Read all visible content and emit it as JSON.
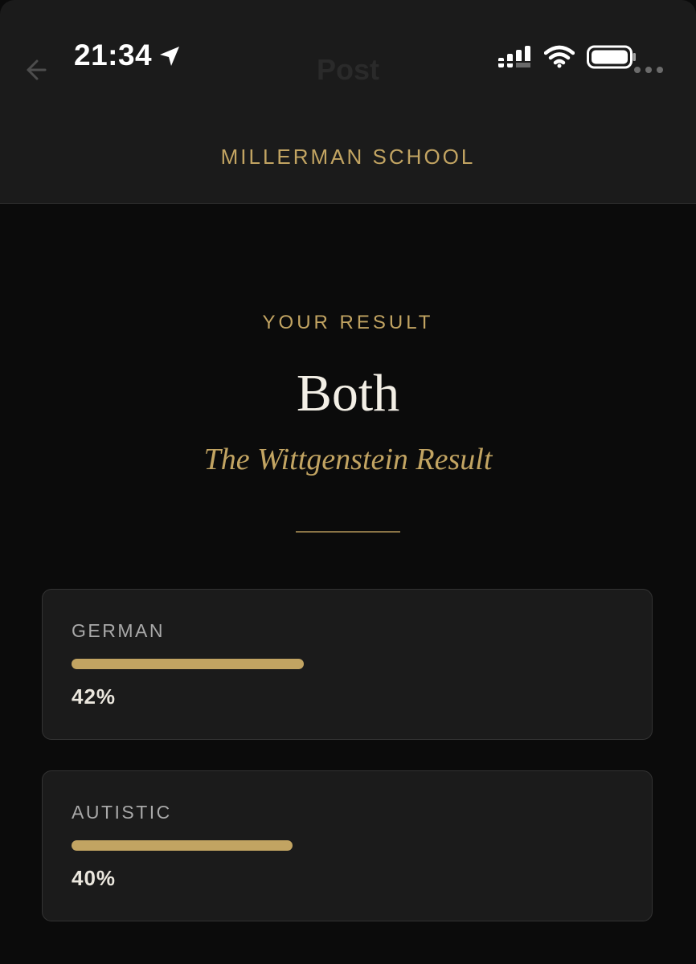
{
  "status_bar": {
    "time": "21:34",
    "icons": [
      "location-arrow-icon",
      "cellular-signal-icon",
      "wifi-icon",
      "battery-icon"
    ]
  },
  "nav": {
    "title": "Post",
    "back_icon": "back-arrow-icon",
    "more_icon": "more-dots-icon"
  },
  "brand": "MILLERMAN SCHOOL",
  "result": {
    "label": "YOUR RESULT",
    "title": "Both",
    "subtitle": "The Wittgenstein Result"
  },
  "scores": [
    {
      "label": "GERMAN",
      "value_text": "42%",
      "percent": 42
    },
    {
      "label": "AUTISTIC",
      "value_text": "40%",
      "percent": 40
    }
  ],
  "colors": {
    "accent_gold": "#c2a462",
    "background": "#0b0b0b",
    "card_background": "#1b1b1b",
    "title_text": "#f3efe6"
  }
}
